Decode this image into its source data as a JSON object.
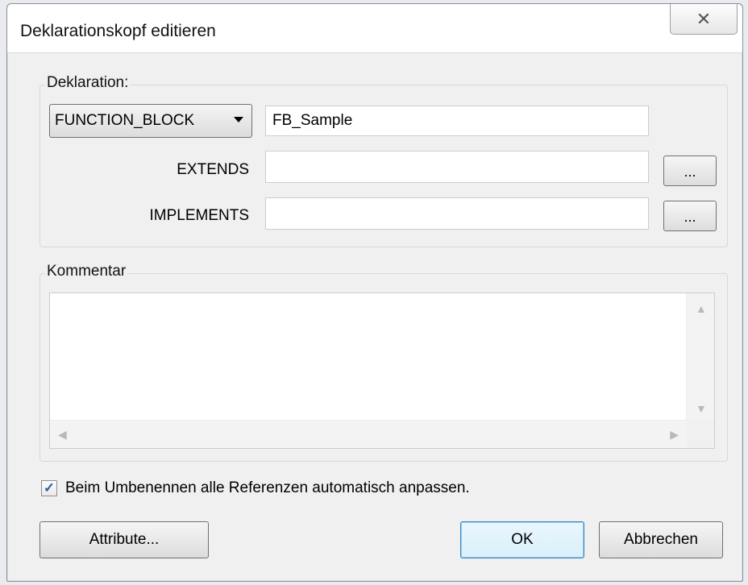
{
  "dialog": {
    "title": "Deklarationskopf editieren",
    "close_glyph": "☒"
  },
  "declaration": {
    "group_label": "Deklaration:",
    "type_selected": "FUNCTION_BLOCK",
    "name_value": "FB_Sample",
    "extends_label": "EXTENDS",
    "extends_value": "",
    "implements_label": "IMPLEMENTS",
    "implements_value": "",
    "browse_label": "..."
  },
  "comment": {
    "group_label": "Kommentar",
    "value": ""
  },
  "options": {
    "rename_checkbox_checked": true,
    "rename_checkbox_label": "Beim Umbenennen alle Referenzen automatisch anpassen."
  },
  "buttons": {
    "attributes": "Attribute...",
    "ok": "OK",
    "cancel": "Abbrechen"
  },
  "icons": {
    "close": "close-icon",
    "dropdown": "chevron-down-icon",
    "scroll_up": "scroll-up-icon",
    "scroll_down": "scroll-down-icon",
    "scroll_left": "scroll-left-icon",
    "scroll_right": "scroll-right-icon",
    "check": "checkmark-icon"
  }
}
